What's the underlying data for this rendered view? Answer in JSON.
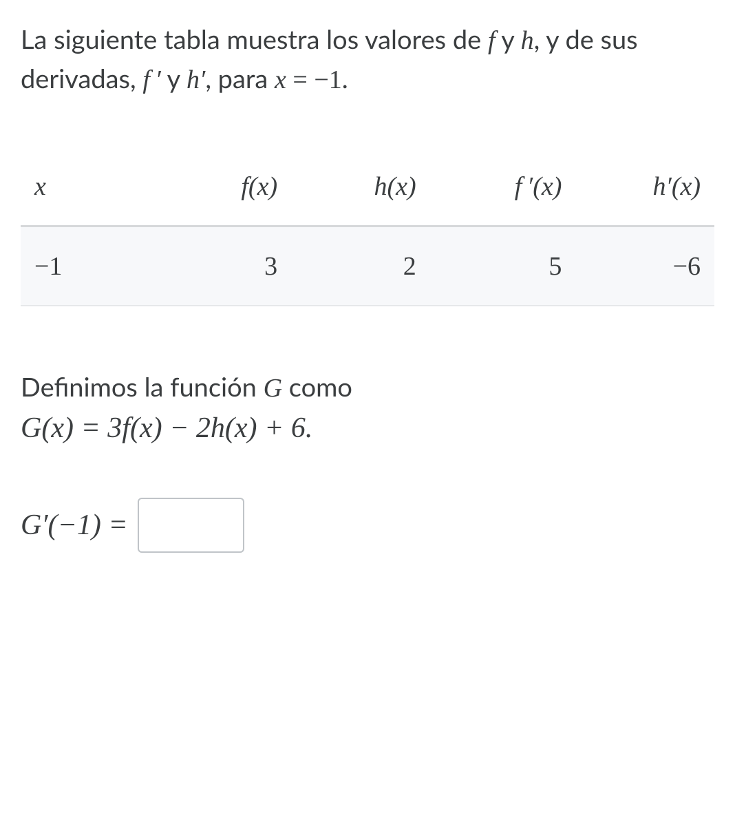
{
  "intro": {
    "part1": "La siguiente tabla muestra los valores de ",
    "f": "f",
    "and1": " y ",
    "h": "h",
    "part2": ", y de sus derivadas, ",
    "fprime": "f ′",
    "and2": " y ",
    "hprime": "h′",
    "part3": ", para ",
    "eq_lhs": "x",
    "eq_eq": " = ",
    "eq_rhs": "−1",
    "period": "."
  },
  "table": {
    "headers": {
      "x": "x",
      "fx": "f(x)",
      "hx": "h(x)",
      "fpx": "f ′(x)",
      "hpx": "h′(x)"
    },
    "row": {
      "x": "−1",
      "fx": "3",
      "hx": "2",
      "fpx": "5",
      "hpx": "−6"
    }
  },
  "definition": {
    "lead": "Definimos la función ",
    "G": "G",
    "lead2": " como",
    "formula": "G(x) = 3f(x) − 2h(x) + 6."
  },
  "question": {
    "lhs": "G′(−1) ="
  },
  "chart_data": {
    "type": "table",
    "x": -1,
    "f(x)": 3,
    "h(x)": 2,
    "f'(x)": 5,
    "h'(x)": -6
  }
}
